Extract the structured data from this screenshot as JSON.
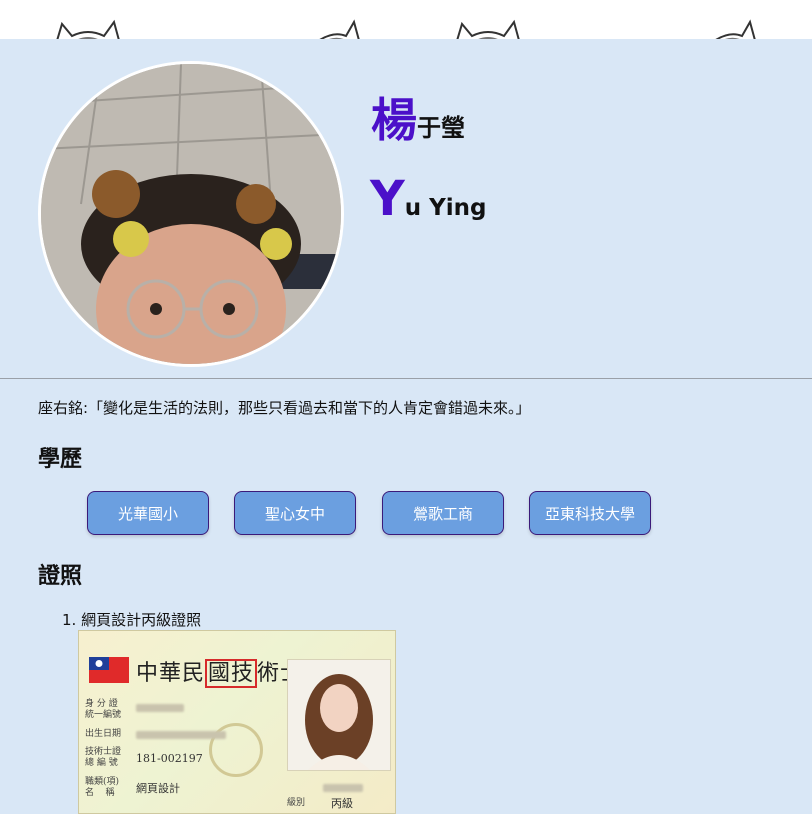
{
  "colors": {
    "background": "#d9e7f6",
    "accent": "#4b10c9",
    "button": "#6b9fe0",
    "button_border": "#3b1a7a"
  },
  "profile": {
    "name_cn_initial": "楊",
    "name_cn_rest": "于瑩",
    "name_en_initial": "Y",
    "name_en_rest": "u Ying"
  },
  "motto": "座右銘:「變化是生活的法則，那些只看過去和當下的人肯定會錯過未來。」",
  "education": {
    "title": "學歷",
    "schools": [
      "光華國小",
      "聖心女中",
      "鶯歌工商",
      "亞東科技大學"
    ]
  },
  "certificates": {
    "title": "證照",
    "items": [
      {
        "number": "1.",
        "label": "網頁設計丙級證照",
        "card": {
          "heading_part1": "中華民",
          "heading_boxed": "國技",
          "heading_part2": "術士證",
          "field_id": "身 分 證\n統一編號",
          "field_birth": "出生日期",
          "field_cert_no": "技術士證\n總 編 號",
          "cert_no": "181-002197",
          "field_category": "職類(項)\n名    稱",
          "category": "網頁設計",
          "field_level": "級別",
          "level": "丙級"
        }
      }
    ]
  }
}
